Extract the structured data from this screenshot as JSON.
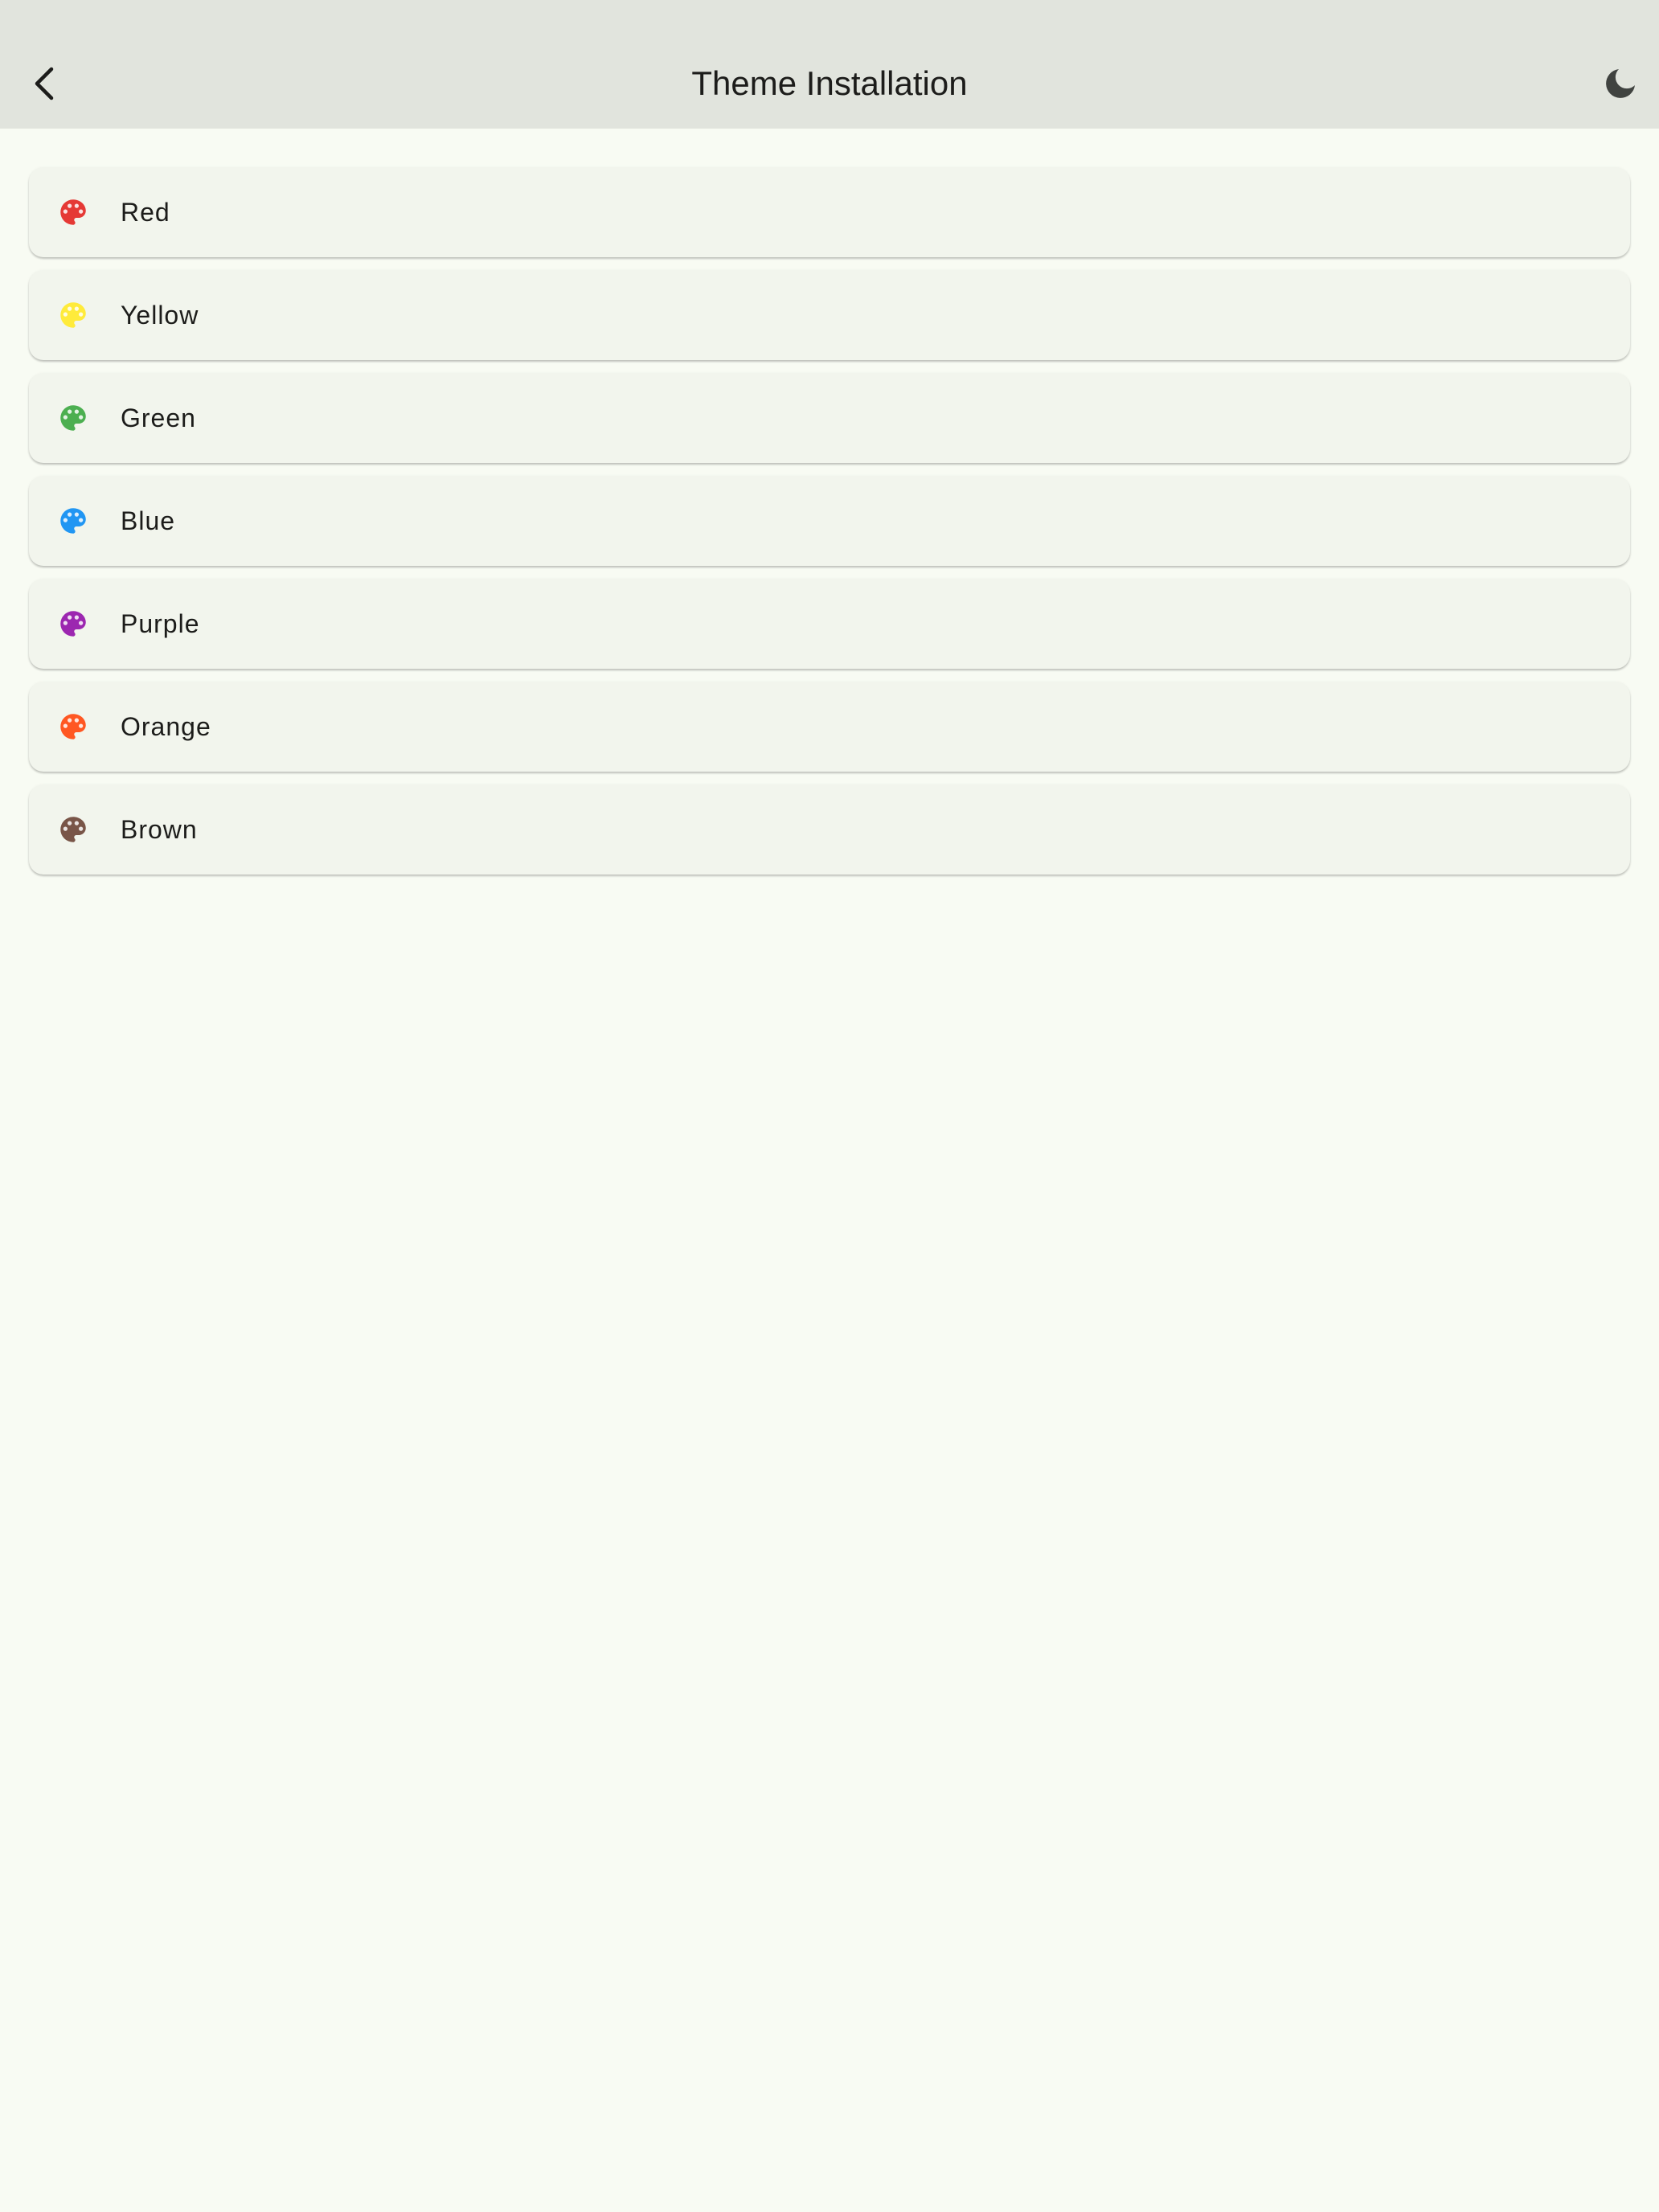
{
  "app_bar": {
    "title": "Theme Installation",
    "back_icon": "chevron-left-icon",
    "theme_toggle_icon": "moon-icon"
  },
  "themes": [
    {
      "label": "Red",
      "color": "#e53935",
      "icon": "palette-icon"
    },
    {
      "label": "Yellow",
      "color": "#ffeb3b",
      "icon": "palette-icon"
    },
    {
      "label": "Green",
      "color": "#4caf50",
      "icon": "palette-icon"
    },
    {
      "label": "Blue",
      "color": "#2196f3",
      "icon": "palette-icon"
    },
    {
      "label": "Purple",
      "color": "#9c27b0",
      "icon": "palette-icon"
    },
    {
      "label": "Orange",
      "color": "#ff5722",
      "icon": "palette-icon"
    },
    {
      "label": "Brown",
      "color": "#795548",
      "icon": "palette-icon"
    }
  ]
}
